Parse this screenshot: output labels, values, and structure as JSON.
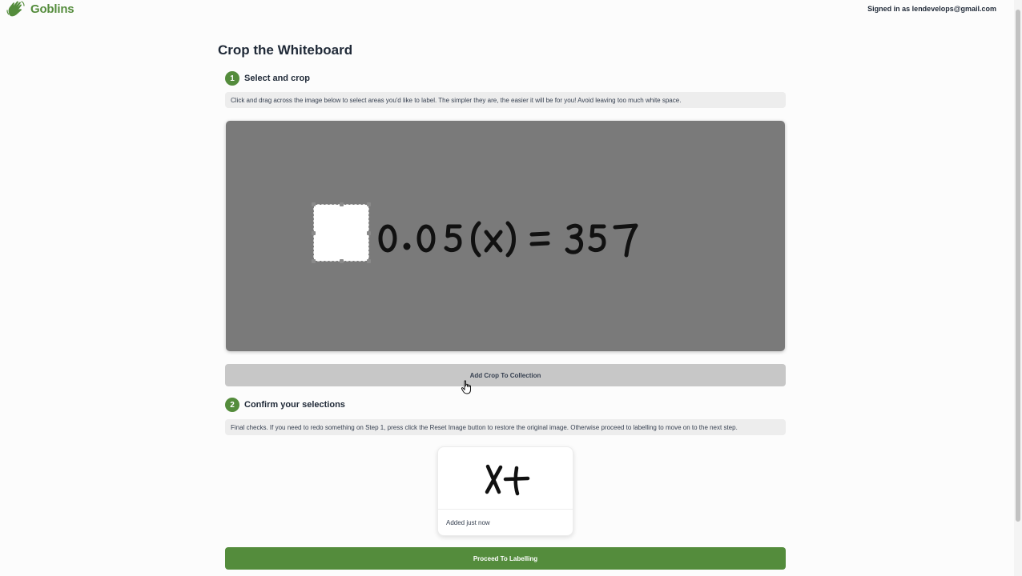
{
  "header": {
    "brand": "Goblins",
    "signed_in": "Signed in as lendevelops@gmail.com",
    "logo_icon": "waving-hand-icon"
  },
  "main": {
    "title": "Crop the Whiteboard",
    "step1": {
      "number": "1",
      "label": "Select and crop",
      "hint": "Click and drag across the image below to select areas you'd like to label. The simpler they are, the easier it will be for you! Avoid leaving too much white space."
    },
    "canvas": {
      "equation": "0.05(x) = 357"
    },
    "add_button": "Add Crop To Collection",
    "step2": {
      "number": "2",
      "label": "Confirm your selections",
      "hint": "Final checks. If you need to redo something on Step 1, press click the Reset Image button to restore the original image. Otherwise proceed to labelling to move on to the next step."
    },
    "crops": [
      {
        "content": "x+",
        "caption": "Added just now"
      }
    ],
    "proceed_button": "Proceed To Labelling"
  },
  "colors": {
    "brand": "#548c3c",
    "canvas": "#7a7a7a",
    "add_button": "#c7c7c7"
  }
}
